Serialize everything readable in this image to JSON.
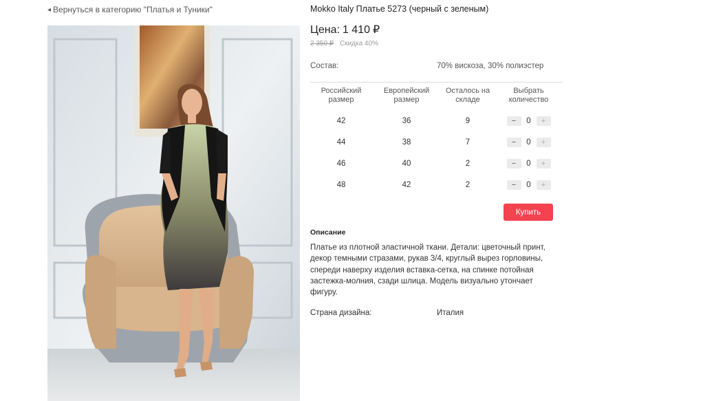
{
  "back_link": {
    "text": "Вернуться в категорию \"Платья и Туники\""
  },
  "product": {
    "title": "Mokko Italy Платье 5273 (черный с зеленым)",
    "price_label": "Цена:",
    "price": "1 410",
    "currency": "₽",
    "old_price": "2 350 ₽",
    "discount": "Скидка 40%"
  },
  "composition": {
    "label": "Состав:",
    "value": "70% вискоза, 30% полиэстер"
  },
  "size_table": {
    "headers": [
      "Российский размер",
      "Европейский размер",
      "Осталось на складе",
      "Выбрать количество"
    ],
    "rows": [
      {
        "ru": "42",
        "eu": "36",
        "stock": "9",
        "qty": "0",
        "minus": "−",
        "plus": "+"
      },
      {
        "ru": "44",
        "eu": "38",
        "stock": "7",
        "qty": "0",
        "minus": "−",
        "plus": "+"
      },
      {
        "ru": "46",
        "eu": "40",
        "stock": "2",
        "qty": "0",
        "minus": "−",
        "plus": "+"
      },
      {
        "ru": "48",
        "eu": "42",
        "stock": "2",
        "qty": "0",
        "minus": "−",
        "plus": "+"
      }
    ]
  },
  "buy_button": {
    "label": "Купить",
    "color": "#f2434f"
  },
  "description": {
    "title": "Описание",
    "text": "Платье из плотной эластичной ткани. Детали: цветочный принт, декор темными стразами, рукав 3/4, круглый вырез горловины, спереди наверху изделия вставка-сетка, на спинке потойная застежка-молния, сзади шлица. Модель визуально утончает фигуру."
  },
  "design_country": {
    "label": "Страна дизайна:",
    "value": "Италия"
  },
  "icons": {
    "back": "back-arrow-icon"
  }
}
